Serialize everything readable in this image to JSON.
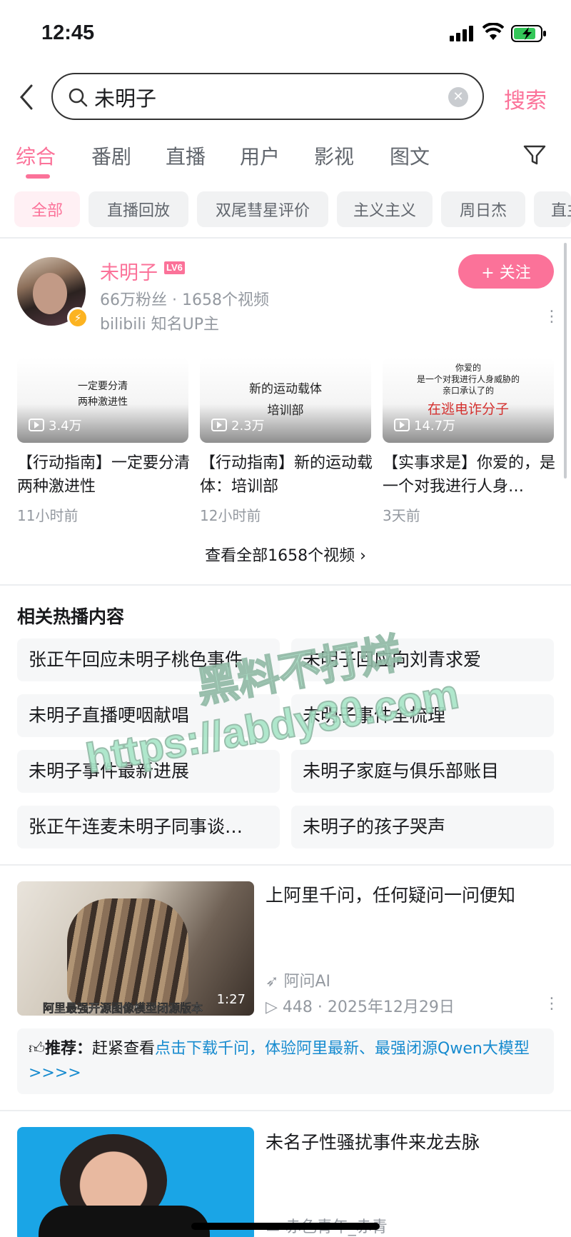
{
  "status": {
    "time": "12:45"
  },
  "search": {
    "query": "未明子",
    "button": "搜索"
  },
  "tabs": [
    "综合",
    "番剧",
    "直播",
    "用户",
    "影视",
    "图文"
  ],
  "chips": [
    "全部",
    "直播回放",
    "双尾彗星评价",
    "主义主义",
    "周日杰",
    "直主"
  ],
  "user": {
    "name": "未明子",
    "level": "LV6",
    "stats": "66万粉丝 · 1658个视频",
    "desc": "bilibili 知名UP主",
    "follow": "+ 关注"
  },
  "videos": [
    {
      "thumb_lines": [
        "一定要分清",
        "两种激进性"
      ],
      "views": "3.4万",
      "title": "【行动指南】一定要分清两种激进性",
      "time": "11小时前"
    },
    {
      "thumb_lines": [
        "新的运动载体",
        "培训部"
      ],
      "views": "2.3万",
      "title": "【行动指南】新的运动载体：培训部",
      "time": "12小时前"
    },
    {
      "thumb_lines": [
        "你爱的",
        "是一个对我进行人身威胁的",
        "亲口承认了的",
        "在逃电诈分子"
      ],
      "views": "14.7万",
      "title": "【实事求是】你爱的，是一个对我进行人身…",
      "time": "3天前"
    }
  ],
  "view_all": "查看全部1658个视频 ›",
  "hot": {
    "title": "相关热播内容",
    "items": [
      "张正午回应未明子桃色事件",
      "未明子回应向刘青求爱",
      "未明子直播哽咽献唱",
      "未明子事件全梳理",
      "未明子事件最新进展",
      "未明子家庭与俱乐部账目",
      "张正午连麦未明子同事谈…",
      "未明子的孩子哭声"
    ]
  },
  "watermark": {
    "line1": "黑料不打烊",
    "line2": "https://abdy30.com"
  },
  "ad": {
    "caption": "阿里最强开源图像模型闭源版本",
    "duration": "1:27",
    "title": "上阿里千问，任何疑问一问便知",
    "source": "阿问AI",
    "meta": "448 · 2025年12月29日",
    "rec_label": "推荐：",
    "rec_text": "赶紧查看",
    "rec_link": "点击下载千问，体验阿里最新、最强闭源Qwen大模型>>>>"
  },
  "video2": {
    "title": "未名子性骚扰事件来龙去脉",
    "source": "赤色青年_赤青"
  }
}
